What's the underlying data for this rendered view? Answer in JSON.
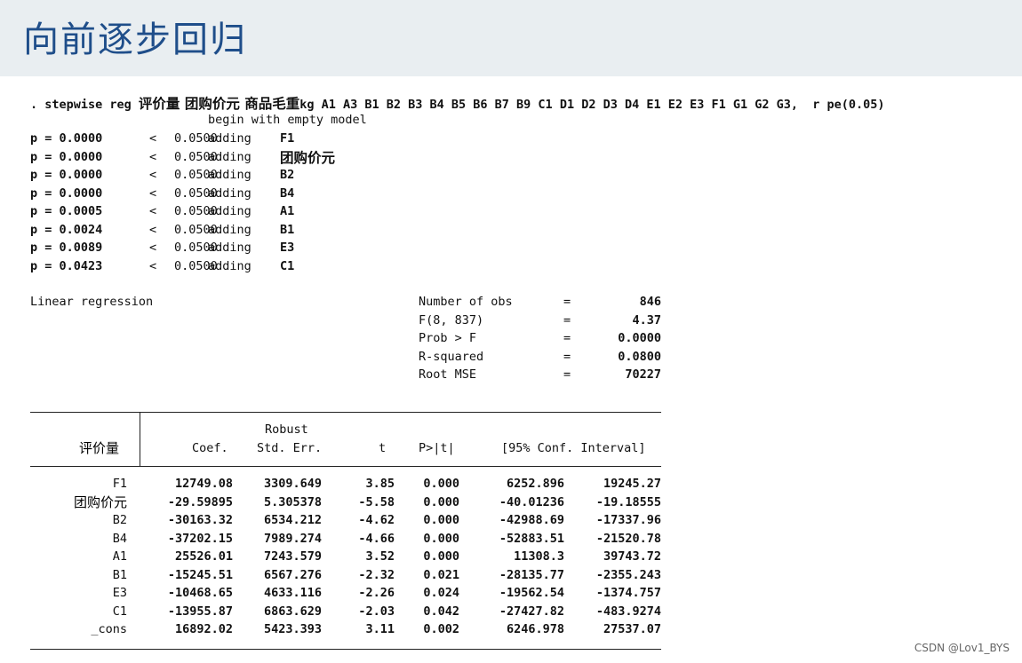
{
  "title": "向前逐步回归",
  "command": {
    "prefix": ". stepwise reg ",
    "cjk_vars": "评价量 团购价元 商品毛重",
    "suffix": "kg A1 A3 B1 B2 B3 B4 B5 B6 B7 B9 C1 D1 D2 D3 D4 E1 E2 E3 F1 G1 G2 G3,  r pe(0.05)"
  },
  "begin_text": "begin with empty model",
  "steps": [
    {
      "p": "p = 0.0000",
      "lt": "<",
      "pe": "0.0500",
      "action": "adding",
      "var": "F1"
    },
    {
      "p": "p = 0.0000",
      "lt": "<",
      "pe": "0.0500",
      "action": "adding",
      "var": "团购价元"
    },
    {
      "p": "p = 0.0000",
      "lt": "<",
      "pe": "0.0500",
      "action": "adding",
      "var": "B2"
    },
    {
      "p": "p = 0.0000",
      "lt": "<",
      "pe": "0.0500",
      "action": "adding",
      "var": "B4"
    },
    {
      "p": "p = 0.0005",
      "lt": "<",
      "pe": "0.0500",
      "action": "adding",
      "var": "A1"
    },
    {
      "p": "p = 0.0024",
      "lt": "<",
      "pe": "0.0500",
      "action": "adding",
      "var": "B1"
    },
    {
      "p": "p = 0.0089",
      "lt": "<",
      "pe": "0.0500",
      "action": "adding",
      "var": "E3"
    },
    {
      "p": "p = 0.0423",
      "lt": "<",
      "pe": "0.0500",
      "action": "adding",
      "var": "C1"
    }
  ],
  "model_label": "Linear regression",
  "stats": [
    {
      "label": "Number of obs",
      "eq": "=",
      "value": "846"
    },
    {
      "label": "F(8, 837)",
      "eq": "=",
      "value": "4.37"
    },
    {
      "label": "Prob > F",
      "eq": "=",
      "value": "0.0000"
    },
    {
      "label": "R-squared",
      "eq": "=",
      "value": "0.0800"
    },
    {
      "label": "Root MSE",
      "eq": "=",
      "value": "70227"
    }
  ],
  "table": {
    "depvar": "评价量",
    "robust_label": "Robust",
    "headers": [
      "Coef.",
      "Std. Err.",
      "t",
      "P>|t|",
      "[95% Conf. Interval]"
    ],
    "rows": [
      {
        "var": "F1",
        "coef": "12749.08",
        "se": "3309.649",
        "t": "3.85",
        "p": "0.000",
        "lo": "6252.896",
        "hi": "19245.27"
      },
      {
        "var": "团购价元",
        "coef": "-29.59895",
        "se": "5.305378",
        "t": "-5.58",
        "p": "0.000",
        "lo": "-40.01236",
        "hi": "-19.18555"
      },
      {
        "var": "B2",
        "coef": "-30163.32",
        "se": "6534.212",
        "t": "-4.62",
        "p": "0.000",
        "lo": "-42988.69",
        "hi": "-17337.96"
      },
      {
        "var": "B4",
        "coef": "-37202.15",
        "se": "7989.274",
        "t": "-4.66",
        "p": "0.000",
        "lo": "-52883.51",
        "hi": "-21520.78"
      },
      {
        "var": "A1",
        "coef": "25526.01",
        "se": "7243.579",
        "t": "3.52",
        "p": "0.000",
        "lo": "11308.3",
        "hi": "39743.72"
      },
      {
        "var": "B1",
        "coef": "-15245.51",
        "se": "6567.276",
        "t": "-2.32",
        "p": "0.021",
        "lo": "-28135.77",
        "hi": "-2355.243"
      },
      {
        "var": "E3",
        "coef": "-10468.65",
        "se": "4633.116",
        "t": "-2.26",
        "p": "0.024",
        "lo": "-19562.54",
        "hi": "-1374.757"
      },
      {
        "var": "C1",
        "coef": "-13955.87",
        "se": "6863.629",
        "t": "-2.03",
        "p": "0.042",
        "lo": "-27427.82",
        "hi": "-483.9274"
      },
      {
        "var": "_cons",
        "coef": "16892.02",
        "se": "5423.393",
        "t": "3.11",
        "p": "0.002",
        "lo": "6246.978",
        "hi": "27537.07"
      }
    ]
  },
  "watermark": "CSDN @Lov1_BYS"
}
